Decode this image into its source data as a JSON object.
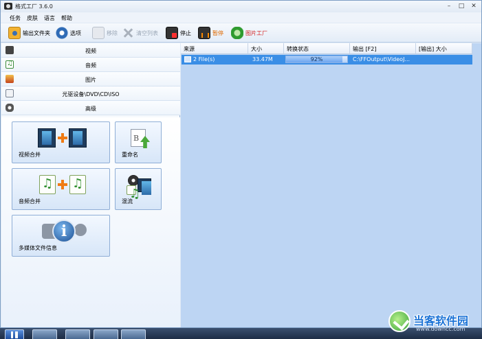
{
  "window": {
    "title": "格式工厂 3.6.0",
    "controls": {
      "minimize": "–",
      "maximize": "□",
      "close": "✕"
    }
  },
  "menu": [
    "任务",
    "皮肤",
    "语言",
    "帮助"
  ],
  "toolbar": {
    "output_folder": "输出文件夹",
    "options": "选项",
    "remove": "移除",
    "clear_list": "清空列表",
    "stop": "停止",
    "pause": "暂停",
    "picture_factory": "图片工厂"
  },
  "categories": [
    {
      "label": "视频",
      "icon": "video-icon"
    },
    {
      "label": "音频",
      "icon": "audio-icon"
    },
    {
      "label": "图片",
      "icon": "image-icon"
    },
    {
      "label": "光驱设备\\DVD\\CD\\ISO",
      "icon": "disc-icon"
    },
    {
      "label": "高级",
      "icon": "advanced-icon"
    }
  ],
  "tools": {
    "video_merge": "视频合并",
    "rename": "重命名",
    "audio_merge": "音频合并",
    "mux": "混流",
    "media_info": "多媒体文件信息"
  },
  "table": {
    "columns": [
      "来源",
      "大小",
      "转换状态",
      "输出 [F2]",
      "[输出] 大小"
    ],
    "rows": [
      {
        "source": "2 File(s)",
        "size": "33.47M",
        "status_text": "92%",
        "progress": 0.92,
        "output": "C:\\FFOutput\\VideoJ...",
        "output_size": ""
      }
    ]
  },
  "watermark": {
    "name": "当客软件园",
    "url": "www.downcc.com"
  },
  "colors": {
    "selection": "#3a8ee6",
    "list_background": "#bdd5f3",
    "accent_orange": "#f07b14"
  }
}
